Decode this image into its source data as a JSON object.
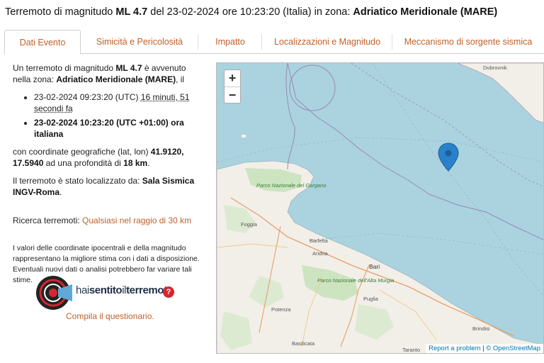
{
  "header": {
    "prefix": "Terremoto di magnitudo",
    "magnitude": "ML 4.7",
    "date_prefix": "del 23-02-2024 ore 10:23:20 (Italia) in zona:",
    "zone": "Adriatico Meridionale (MARE)"
  },
  "tabs": [
    {
      "label": "Dati Evento",
      "active": true
    },
    {
      "label": "Simicità e Pericolosità",
      "active": false
    },
    {
      "label": "Impatto",
      "active": false
    },
    {
      "label": "Localizzazioni e Magnitudo",
      "active": false
    },
    {
      "label": "Meccanismo di sorgente sismica",
      "active": false
    }
  ],
  "info": {
    "intro_1": "Un terremoto di magnitudo",
    "magnitude": "ML 4.7",
    "intro_2": "è avvenuto nella zona:",
    "zone": "Adriatico Meridionale (MARE)",
    "intro_3": ", il",
    "utc_time": "23-02-2024 09:23:20",
    "utc_suffix": "(UTC)",
    "ago": "16 minuti, 51 secondi fa",
    "local_time": "23-02-2024 10:23:20 (UTC +01:00) ora italiana",
    "coord_prefix": "con coordinate geografiche (lat, lon)",
    "coords": "41.9120, 17.5940",
    "depth_prefix": "ad una profondità di",
    "depth": "18 km",
    "loc_prefix": "Il terremoto è stato localizzato da:",
    "loc_by": "Sala Sismica INGV-Roma",
    "search_prefix": "Ricerca terremoti:",
    "search_link": "Qualsiasi nel raggio di 30 km",
    "note": "I valori delle coordinate ipocentrali e della magnitudo rappresentano la migliore stima con i dati a disposizione. Eventuali nuovi dati o analisi potrebbero far variare tali stime."
  },
  "hsit": {
    "word1": "hai",
    "word2": "sentito",
    "word3": "il",
    "word4": "terremoto",
    "badge": "?",
    "cta": "Compila il questionario."
  },
  "map": {
    "zoom_in": "+",
    "zoom_out": "−",
    "labels": {
      "dubrovnik": "Dubrovnik",
      "park_gargano": "Parco Nazionale del Gargano",
      "foggia": "Foggia",
      "barletta": "Barletta",
      "andria": "Andria",
      "bari": "Bari",
      "park_murgia": "Parco Nazionale dell'Alta Murgia",
      "puglia": "Puglia",
      "potenza": "Potenza",
      "basilicata": "Basilicata",
      "brindisi": "Brindisi",
      "taranto": "Taranto"
    },
    "attrib_link": "Report a problem",
    "attrib_sep": "|",
    "attrib_osm": "© OpenStreetMap"
  },
  "colors": {
    "accent": "#c0602a",
    "sea": "#aad3df",
    "land": "#f2efe9",
    "marker": "#2a81cb",
    "badge": "#d7262e"
  }
}
